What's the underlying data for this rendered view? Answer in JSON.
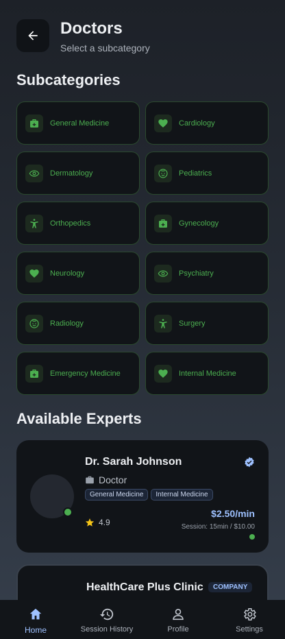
{
  "header": {
    "title": "Doctors",
    "subtitle": "Select a subcategory"
  },
  "subcategories": {
    "heading": "Subcategories",
    "items": [
      {
        "label": "General Medicine",
        "icon": "medical-bag-icon"
      },
      {
        "label": "Cardiology",
        "icon": "heart-icon"
      },
      {
        "label": "Dermatology",
        "icon": "eye-icon"
      },
      {
        "label": "Pediatrics",
        "icon": "child-face-icon"
      },
      {
        "label": "Orthopedics",
        "icon": "accessibility-icon"
      },
      {
        "label": "Gynecology",
        "icon": "medical-bag-icon"
      },
      {
        "label": "Neurology",
        "icon": "heart-icon"
      },
      {
        "label": "Psychiatry",
        "icon": "eye-icon"
      },
      {
        "label": "Radiology",
        "icon": "child-face-icon"
      },
      {
        "label": "Surgery",
        "icon": "accessibility-icon"
      },
      {
        "label": "Emergency Medicine",
        "icon": "medical-bag-icon"
      },
      {
        "label": "Internal Medicine",
        "icon": "heart-icon"
      }
    ]
  },
  "experts": {
    "heading": "Available Experts",
    "cards": [
      {
        "name": "Dr. Sarah Johnson",
        "role": "Doctor",
        "tags": [
          "General Medicine",
          "Internal Medicine"
        ],
        "rating": "4.9",
        "price": "$2.50/min",
        "session": "Session: 15min / $10.00"
      },
      {
        "name": "HealthCare Plus Clinic",
        "badge": "COMPANY"
      }
    ]
  },
  "nav": {
    "items": [
      {
        "label": "Home",
        "icon": "home-icon",
        "active": true
      },
      {
        "label": "Session History",
        "icon": "history-icon"
      },
      {
        "label": "Profile",
        "icon": "person-icon"
      },
      {
        "label": "Settings",
        "icon": "gear-icon"
      }
    ]
  },
  "colors": {
    "accent_green": "#4caf50",
    "accent_blue": "#9ec1ff",
    "card_bg": "#111418"
  }
}
